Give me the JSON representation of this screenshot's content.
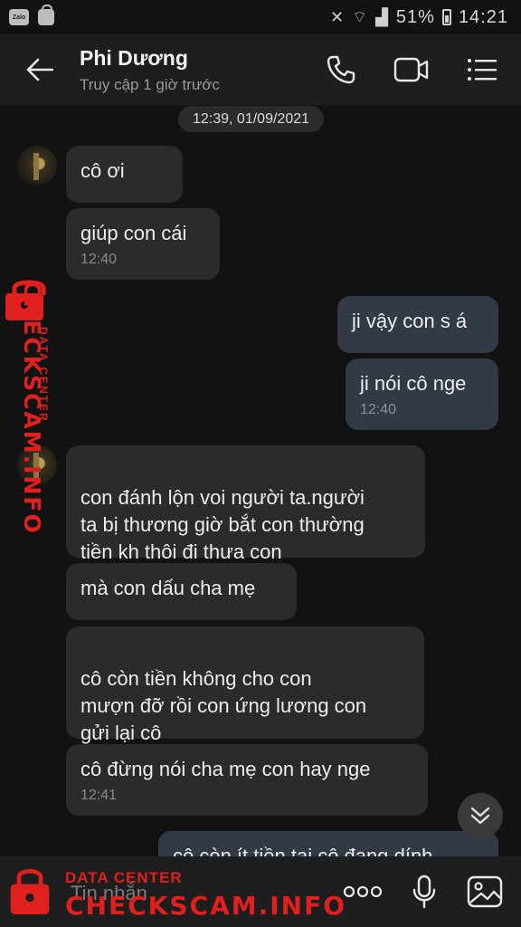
{
  "status_bar": {
    "battery": "51%",
    "time": "14:21"
  },
  "header": {
    "name": "Phi Dương",
    "status": "Truy cập 1 giờ trước"
  },
  "chat": {
    "date": "12:39, 01/09/2021",
    "messages": [
      {
        "dir": "in",
        "text": "cô ơi",
        "time": ""
      },
      {
        "dir": "in",
        "text": "giúp con cái",
        "time": "12:40"
      },
      {
        "dir": "out",
        "text": "ji vậy con s á",
        "time": ""
      },
      {
        "dir": "out",
        "text": "ji nói cô nge",
        "time": "12:40"
      },
      {
        "dir": "in",
        "text": "con đánh lộn voi người ta.người\nta bị thương giờ bắt con thường\ntiền kh thôi đi thưa con",
        "time": ""
      },
      {
        "dir": "in",
        "text": "mà con dấu cha mẹ",
        "time": ""
      },
      {
        "dir": "in",
        "text": "cô còn tiền không cho con\nmượn đỡ rồi con ứng lương con\ngửi lại cô",
        "time": ""
      },
      {
        "dir": "in",
        "text": "cô đừng nói cha mẹ con hay nge",
        "time": "12:41"
      },
      {
        "dir": "out",
        "text": "cô còn ít tiền tại cô đang dính",
        "time": ""
      }
    ]
  },
  "input": {
    "placeholder": "Tin nhắn"
  },
  "watermark": {
    "brand": "CHECKSCAM.INFO",
    "tagline": "DATA CENTER"
  },
  "colors": {
    "background": "#121212",
    "bubble_in": "#2b2b2b",
    "bubble_out": "#323a46",
    "watermark": "#e0201f"
  }
}
